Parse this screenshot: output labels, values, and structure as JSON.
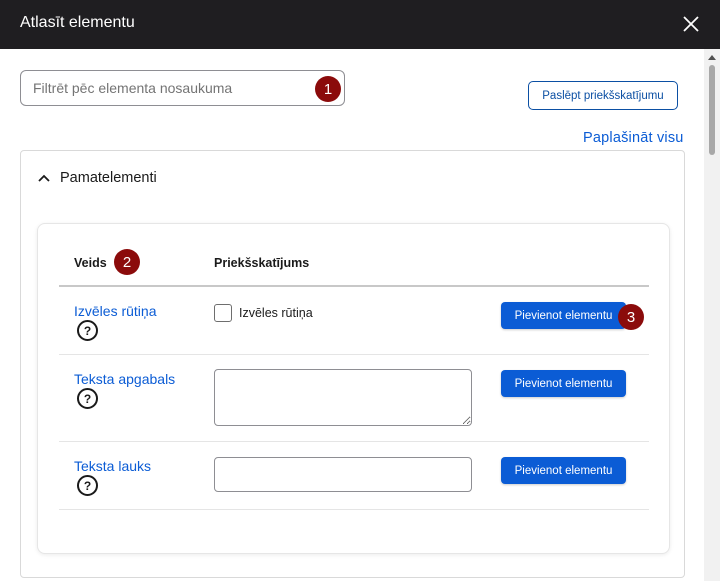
{
  "dialog": {
    "title": "Atlasīt elementu",
    "close_icon": "close-icon"
  },
  "filter": {
    "placeholder": "Filtrēt pēc elementa nosaukuma",
    "value": ""
  },
  "hide_preview_label": "Paslēpt priekšskatījumu",
  "expand_all_label": "Paplašināt visu",
  "section": {
    "title": "Pamatelementi",
    "chevron_icon": "chevron-up-icon"
  },
  "table": {
    "headers": {
      "type": "Veids",
      "preview": "Priekšskatījums"
    },
    "rows": [
      {
        "type_label": "Izvēles rūtiņa",
        "preview_kind": "checkbox",
        "preview_label": "Izvēles rūtiņa",
        "add_label": "Pievienot elementu"
      },
      {
        "type_label": "Teksta apgabals",
        "preview_kind": "textarea",
        "add_label": "Pievienot elementu"
      },
      {
        "type_label": "Teksta lauks",
        "preview_kind": "text-input",
        "add_label": "Pievienot elementu"
      }
    ],
    "help_glyph": "?"
  },
  "markers": [
    "1",
    "2",
    "3"
  ],
  "colors": {
    "titlebar": "#1f1e21",
    "accent": "#0b5cd5",
    "marker": "#8b0b0b"
  }
}
